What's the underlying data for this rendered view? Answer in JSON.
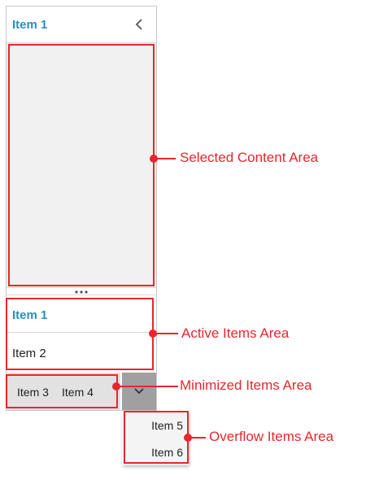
{
  "header": {
    "title": "Item 1"
  },
  "active_items": [
    {
      "label": "Item 1"
    },
    {
      "label": "Item 2"
    }
  ],
  "minimized_items": [
    {
      "label": "Item 3"
    },
    {
      "label": "Item 4"
    }
  ],
  "overflow_items": [
    {
      "label": "Item 5"
    },
    {
      "label": "Item 6"
    }
  ],
  "callouts": {
    "selected_content": "Selected Content Area",
    "active_items": "Active Items Area",
    "minimized_items": "Minimized Items Area",
    "overflow_items": "Overflow Items Area"
  },
  "colors": {
    "accent": "#2a8fb8",
    "annotation": "#e8262d",
    "content_bg": "#f1f1f1",
    "minimized_bg": "#e2e2e2",
    "overflow_button_bg": "#a0a0a0"
  }
}
